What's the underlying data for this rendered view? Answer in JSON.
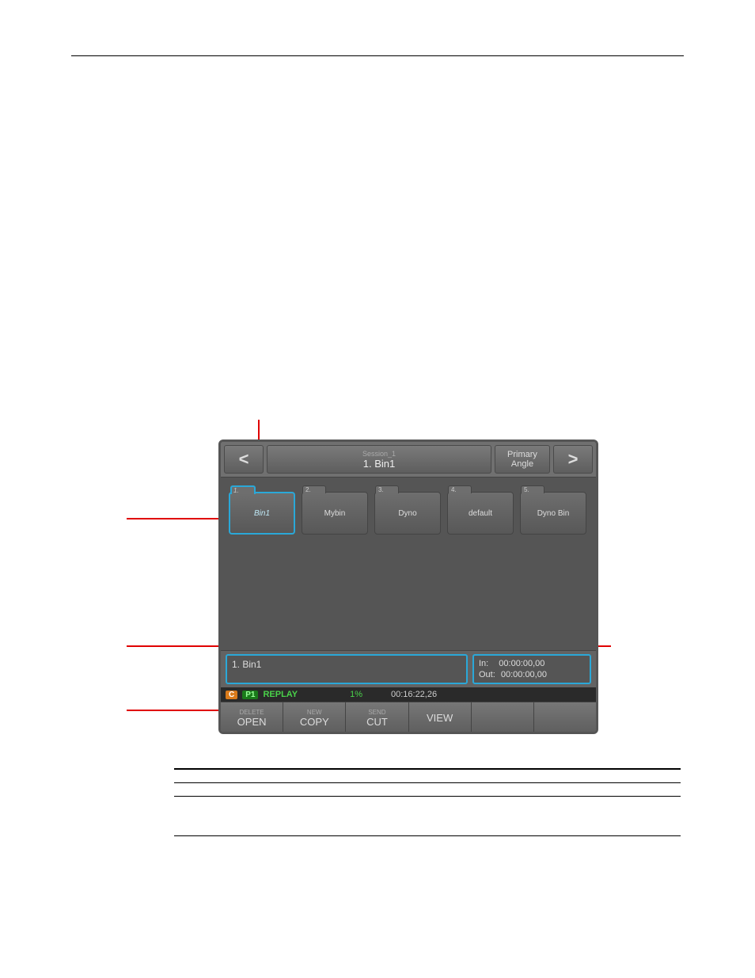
{
  "topbar": {
    "session": "Session_1",
    "bin": "1. Bin1",
    "angle_line1": "Primary",
    "angle_line2": "Angle",
    "prev": "<",
    "next": ">"
  },
  "bins": [
    {
      "num": "1.",
      "label": "Bin1",
      "selected": true
    },
    {
      "num": "2.",
      "label": "Mybin",
      "selected": false
    },
    {
      "num": "3.",
      "label": "Dyno",
      "selected": false
    },
    {
      "num": "4.",
      "label": "default",
      "selected": false
    },
    {
      "num": "5.",
      "label": "Dyno Bin",
      "selected": false
    }
  ],
  "selection": {
    "name": "1. Bin1",
    "in_label": "In:",
    "in_tc": "00:00:00,00",
    "out_label": "Out:",
    "out_tc": "00:00:00,00"
  },
  "status": {
    "c": "C",
    "p1": "P1",
    "replay": "REPLAY",
    "pct": "1%",
    "tc": "00:16:22,26"
  },
  "buttons": [
    {
      "shift": "DELETE",
      "main": "OPEN"
    },
    {
      "shift": "NEW",
      "main": "COPY"
    },
    {
      "shift": "SEND",
      "main": "CUT"
    },
    {
      "shift": "",
      "main": "VIEW"
    },
    {
      "shift": "",
      "main": ""
    },
    {
      "shift": "",
      "main": ""
    }
  ],
  "table": {
    "headers": [
      "",
      "",
      ""
    ],
    "rows": [
      [
        "",
        "",
        ""
      ],
      [
        "",
        "",
        ""
      ]
    ]
  }
}
